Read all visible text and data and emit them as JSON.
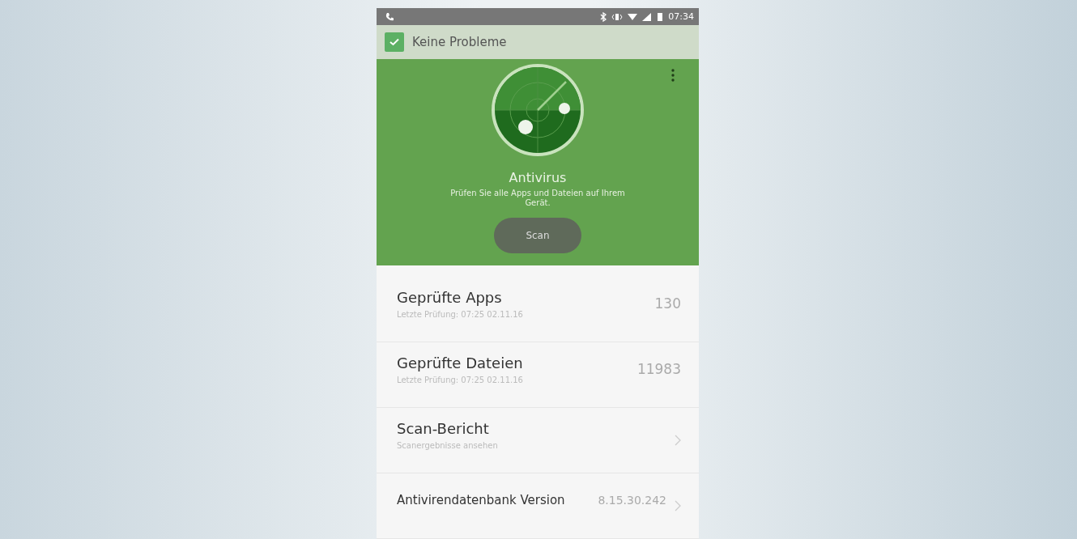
{
  "status_bar": {
    "time": "07:34"
  },
  "status_header": {
    "text": "Keine Probleme",
    "checked": true
  },
  "hero": {
    "title": "Antivirus",
    "description": "Prüfen Sie alle Apps und Dateien auf Ihrem Gerät.",
    "button": "Scan"
  },
  "items": [
    {
      "kind": "count",
      "title": "Geprüfte Apps",
      "subtitle": "Letzte Prüfung: 07:25 02.11.16",
      "value": "130"
    },
    {
      "kind": "count",
      "title": "Geprüfte Dateien",
      "subtitle": "Letzte Prüfung: 07:25 02.11.16",
      "value": "11983"
    },
    {
      "kind": "link",
      "title": "Scan-Bericht",
      "subtitle": "Scanergebnisse ansehen"
    },
    {
      "kind": "link-value",
      "title": "Antivirendatenbank Version",
      "value": "8.15.30.242"
    }
  ]
}
